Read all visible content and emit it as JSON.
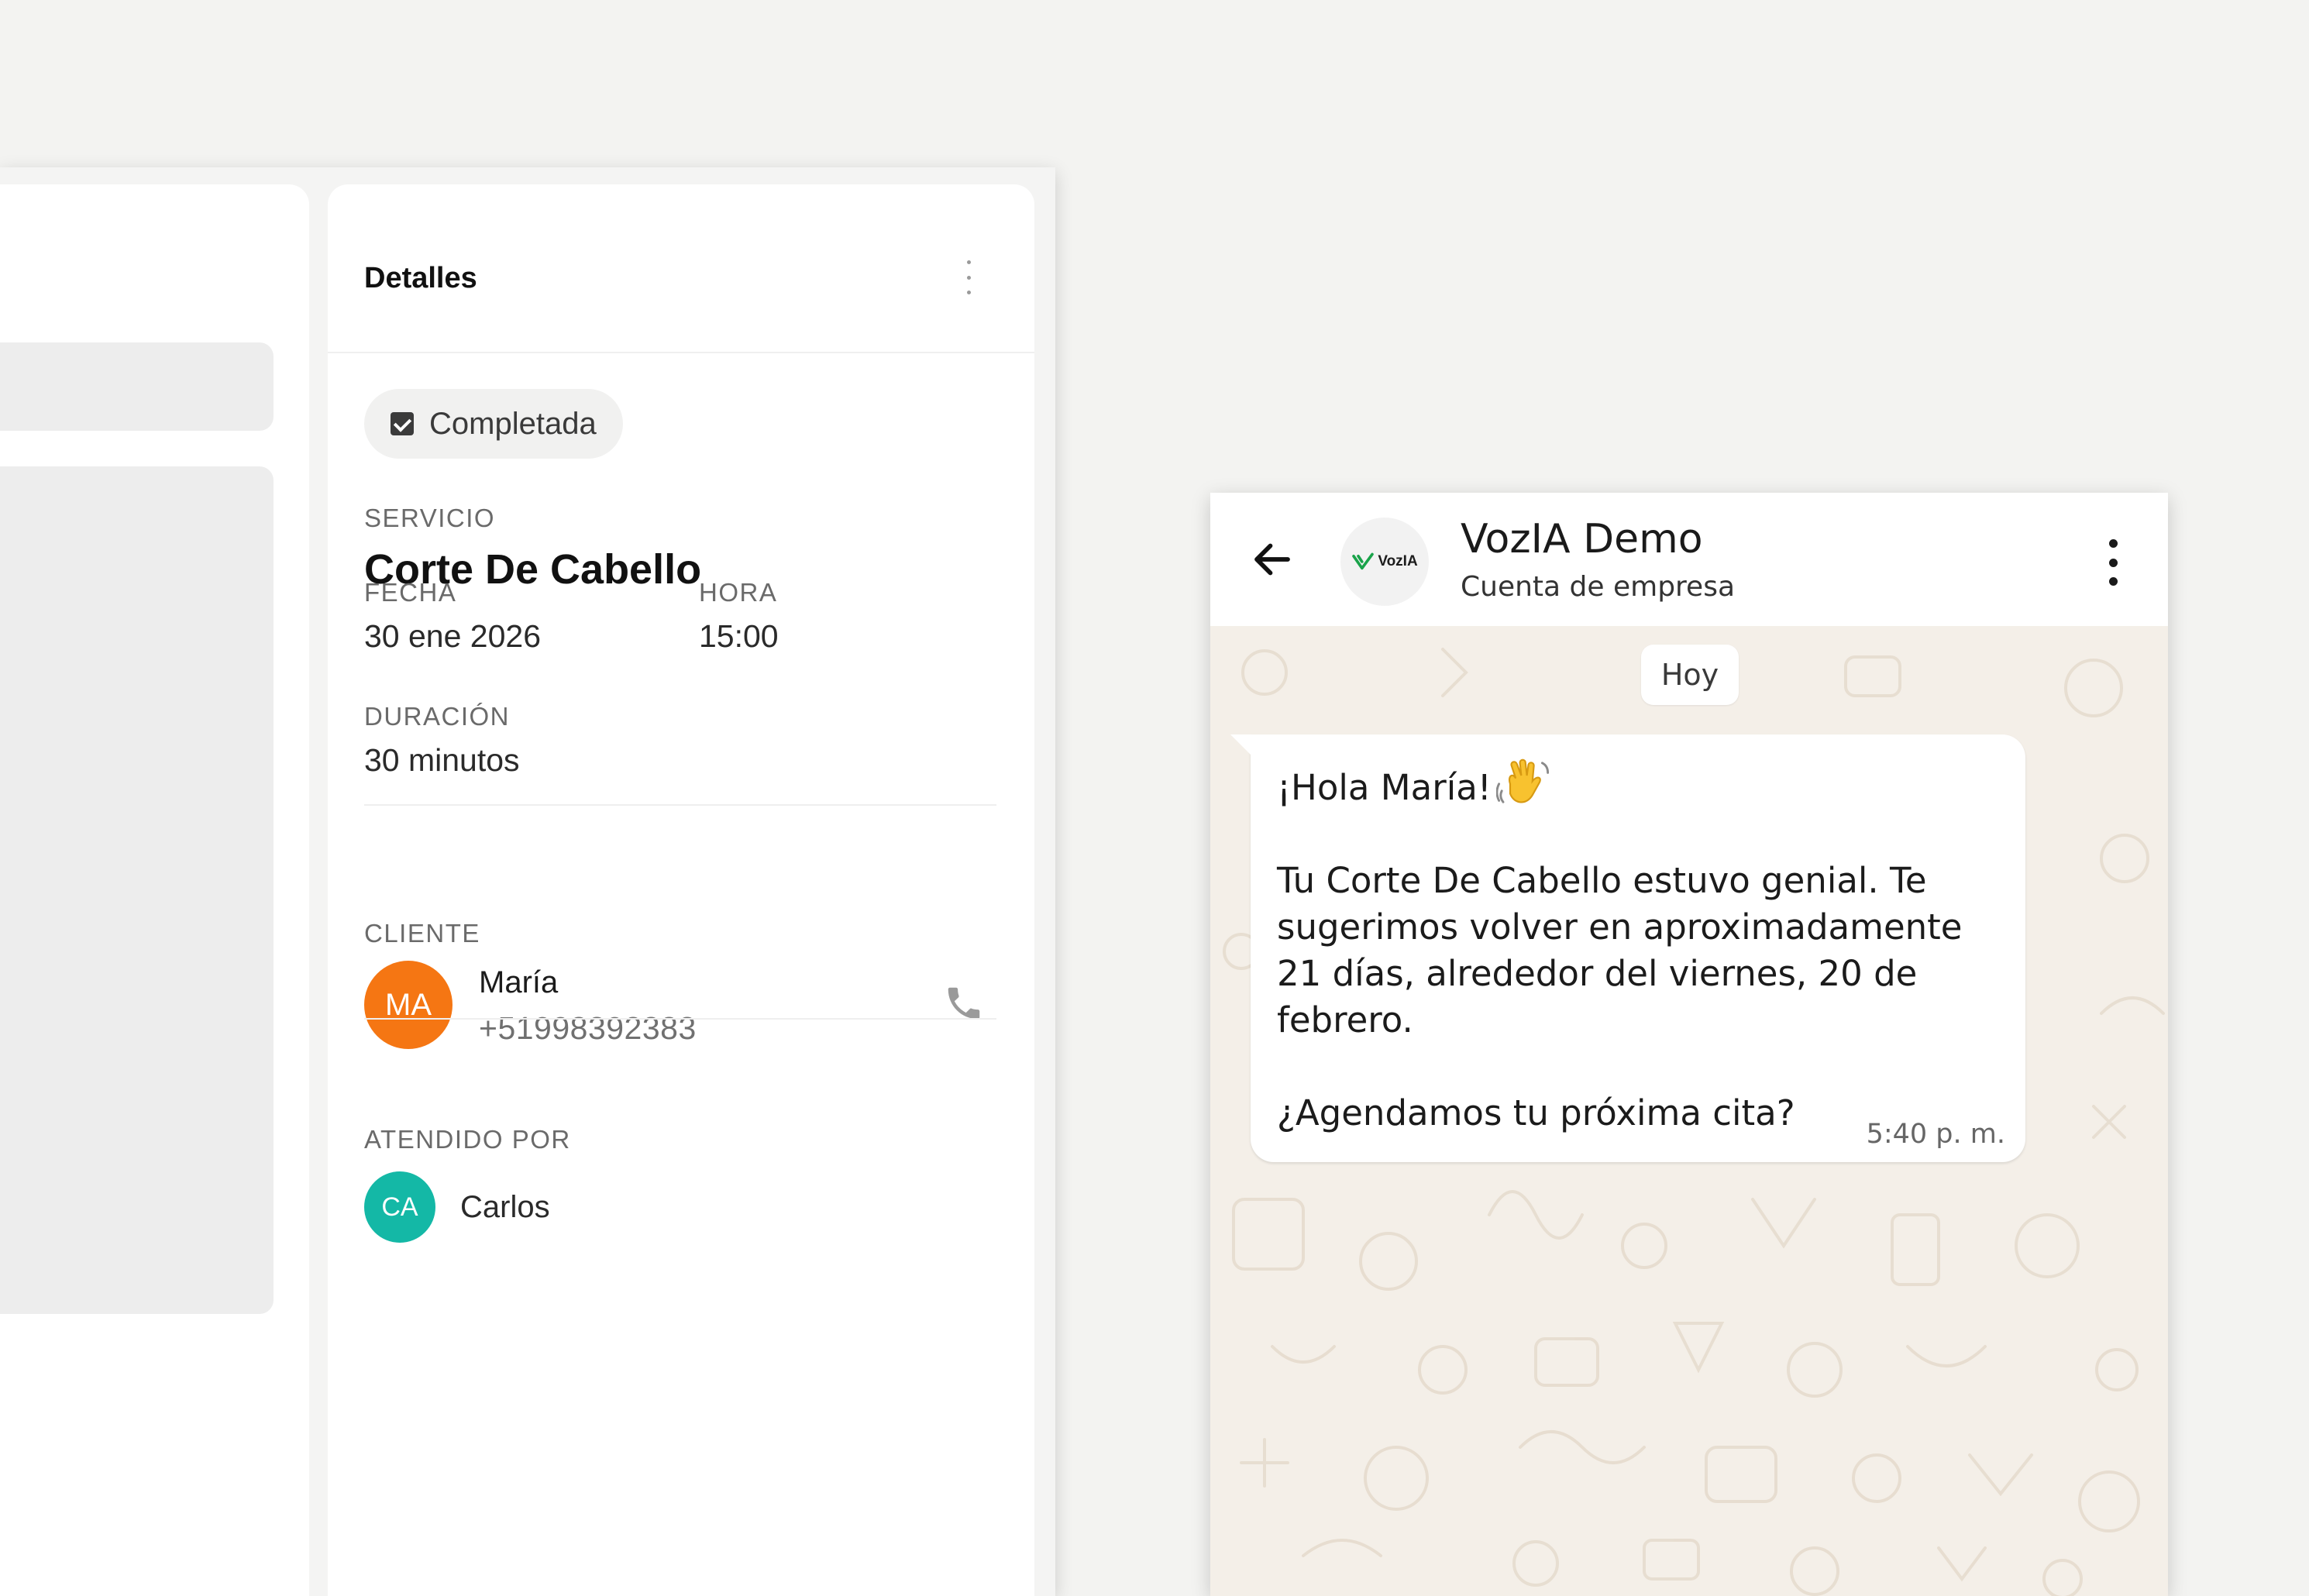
{
  "details_panel": {
    "title": "Detalles",
    "status": "Completada",
    "service_label": "SERVICIO",
    "service": "Corte De Cabello",
    "date_label": "FECHA",
    "date": "30 ene 2026",
    "time_label": "HORA",
    "time": "15:00",
    "duration_label": "DURACIÓN",
    "duration": "30 minutos",
    "client_label": "CLIENTE",
    "client": {
      "initials": "MA",
      "name": "María",
      "phone": "+51998392383",
      "avatar_color": "#f57613"
    },
    "staff_label": "ATENDIDO POR",
    "staff": {
      "initials": "CA",
      "name": "Carlos",
      "avatar_color": "#14b8a6"
    },
    "icons": [
      "more-vertical-icon",
      "checkbox-checked-icon",
      "phone-icon"
    ]
  },
  "chat": {
    "business_name": "VozIA Demo",
    "business_subtitle": "Cuenta de empresa",
    "logo_text": "VozIA",
    "day_chip": "Hoy",
    "message": {
      "greeting": "¡Hola María!",
      "body": "Tu Corte De Cabello estuvo genial. Te sugerimos volver en aproximadamente 21 días, alrededor del viernes, 20 de febrero.",
      "question": "¿Agendamos tu próxima cita?",
      "time": "5:40 p. m."
    },
    "brand_color": "#19a34a",
    "icons": [
      "back-arrow-icon",
      "more-vertical-icon",
      "waving-hand-icon"
    ]
  }
}
